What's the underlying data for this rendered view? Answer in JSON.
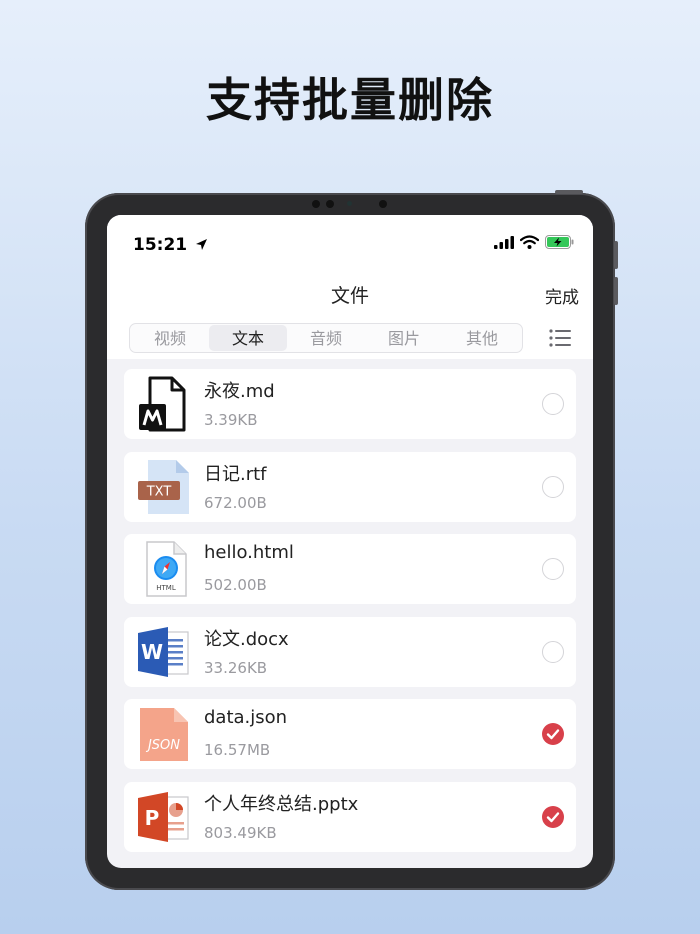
{
  "headline": "支持批量删除",
  "status_bar": {
    "time": "15:21"
  },
  "nav": {
    "title": "文件",
    "done": "完成"
  },
  "tabs": [
    {
      "label": "视频",
      "active": false
    },
    {
      "label": "文本",
      "active": true
    },
    {
      "label": "音频",
      "active": false
    },
    {
      "label": "图片",
      "active": false
    },
    {
      "label": "其他",
      "active": false
    }
  ],
  "files": [
    {
      "name": "永夜.md",
      "size": "3.39KB",
      "icon": "markdown-file-icon",
      "selected": false
    },
    {
      "name": "日记.rtf",
      "size": "672.00B",
      "icon": "txt-file-icon",
      "selected": false,
      "icon_text": "TXT"
    },
    {
      "name": "hello.html",
      "size": "502.00B",
      "icon": "html-file-icon",
      "selected": false,
      "icon_text": "HTML"
    },
    {
      "name": "论文.docx",
      "size": "33.26KB",
      "icon": "word-file-icon",
      "selected": false,
      "icon_text": "W"
    },
    {
      "name": "data.json",
      "size": "16.57MB",
      "icon": "json-file-icon",
      "selected": true,
      "icon_text": "JSON"
    },
    {
      "name": "个人年终总结.pptx",
      "size": "803.49KB",
      "icon": "powerpoint-file-icon",
      "selected": true,
      "icon_text": "P"
    }
  ],
  "colors": {
    "selected": "#d8404a",
    "json": "#f4a48a",
    "word": "#2b5bb5",
    "powerpoint": "#d24726"
  }
}
